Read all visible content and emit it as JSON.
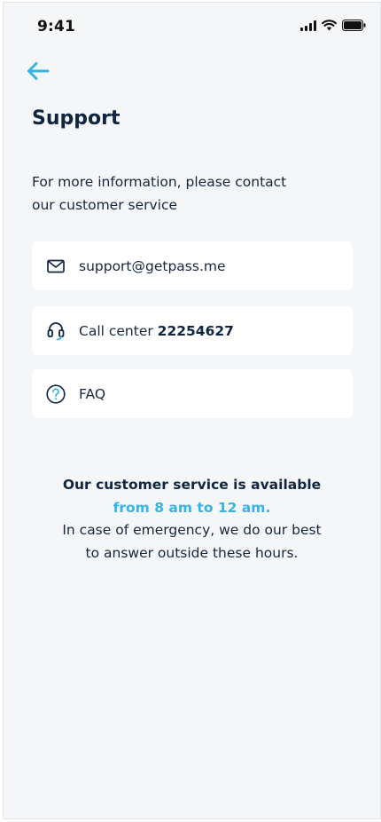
{
  "status_bar": {
    "time": "9:41",
    "icons": [
      "cellular-signal-icon",
      "wifi-icon",
      "battery-icon"
    ]
  },
  "header": {
    "back_icon": "arrow-left-icon",
    "title": "Support"
  },
  "intro": {
    "line1": "For more information, please contact",
    "line2": "our customer service"
  },
  "contacts": {
    "email": {
      "icon": "envelope-icon",
      "value": "support@getpass.me"
    },
    "call": {
      "icon": "headset-icon",
      "label": "Call center ",
      "number": "22254627"
    },
    "faq": {
      "icon": "question-circle-icon",
      "label": "FAQ"
    }
  },
  "availability": {
    "headline": "Our customer service is available",
    "hours": "from 8 am to 12 am.",
    "line3": "In case of emergency, we do our best",
    "line4": "to answer outside these hours."
  },
  "colors": {
    "accent": "#36b4e5",
    "text_dark": "#0f2540",
    "background": "#f4f6f8",
    "card": "#ffffff"
  }
}
